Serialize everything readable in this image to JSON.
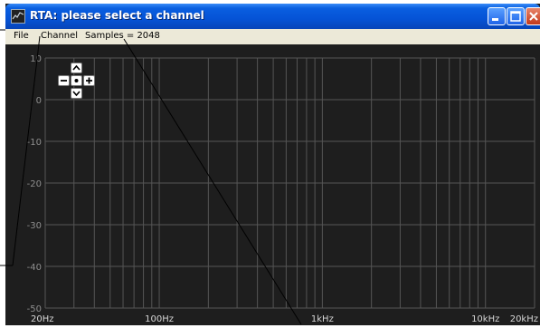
{
  "window": {
    "title": "RTA: please select a channel",
    "controls": [
      "minimize",
      "maximize",
      "close"
    ]
  },
  "menubar": {
    "file": "File",
    "channel": "Channel",
    "samples": "Samples = 2048"
  },
  "zoom_controls": {
    "up": "^",
    "down": "v",
    "minus": "−",
    "plus": "+",
    "center": "•"
  },
  "chart_data": {
    "type": "line",
    "title": "",
    "xlabel": "",
    "ylabel": "",
    "x_scale": "log",
    "xlim": [
      20,
      20000
    ],
    "ylim": [
      -50,
      10
    ],
    "y_ticks": [
      10,
      0,
      -10,
      -20,
      -30,
      -40,
      -50
    ],
    "y_tick_labels": [
      "10",
      "0",
      "-10",
      "-20",
      "-30",
      "-40",
      "-50"
    ],
    "x_tick_labels": [
      {
        "value": 20,
        "label": "20Hz"
      },
      {
        "value": 100,
        "label": "100Hz"
      },
      {
        "value": 1000,
        "label": "1kHz"
      },
      {
        "value": 10000,
        "label": "10kHz"
      },
      {
        "value": 20000,
        "label": "20kHz"
      }
    ],
    "grid": true,
    "series": []
  },
  "colors": {
    "plot_background": "#1e1e1e",
    "grid": "#555555",
    "callout_line": "#000000"
  }
}
